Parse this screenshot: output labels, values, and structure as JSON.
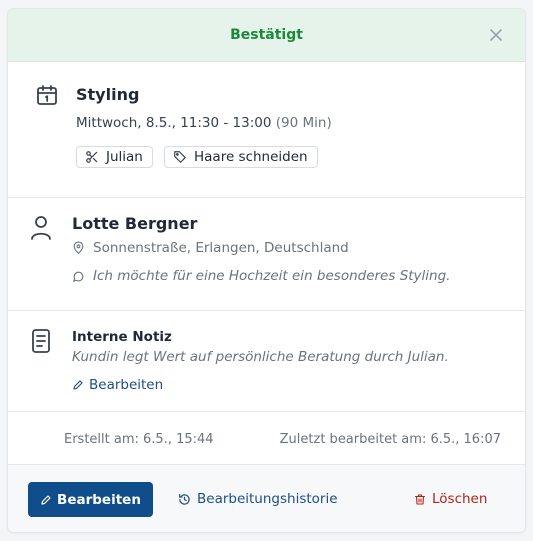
{
  "header": {
    "status": "Bestätigt"
  },
  "appointment": {
    "service": "Styling",
    "datetime": "Mittwoch, 8.5., 11:30 - 13:00",
    "duration": "(90 Min)",
    "staff": "Julian",
    "tag": "Haare schneiden"
  },
  "customer": {
    "name": "Lotte Bergner",
    "address": "Sonnenstraße, Erlangen, Deutschland",
    "message": "Ich möchte für eine Hochzeit ein besonderes Styling."
  },
  "note": {
    "title": "Interne Notiz",
    "text": "Kundin legt Wert auf persönliche Beratung durch Julian.",
    "edit_label": "Bearbeiten"
  },
  "meta": {
    "created": "Erstellt am: 6.5., 15:44",
    "updated": "Zuletzt bearbeitet am: 6.5., 16:07"
  },
  "footer": {
    "edit_label": "Bearbeiten",
    "history_label": "Bearbeitungshistorie",
    "delete_label": "Löschen"
  },
  "colors": {
    "status_bg": "#e6f3ea",
    "status_text": "#1a8a3a",
    "primary": "#0f4e8a",
    "link": "#1d4f85",
    "danger": "#b42318"
  },
  "icons": [
    "close-icon",
    "calendar-icon",
    "scissors-icon",
    "tag-icon",
    "user-icon",
    "map-pin-icon",
    "message-icon",
    "document-icon",
    "pencil-icon",
    "history-icon",
    "trash-icon"
  ]
}
